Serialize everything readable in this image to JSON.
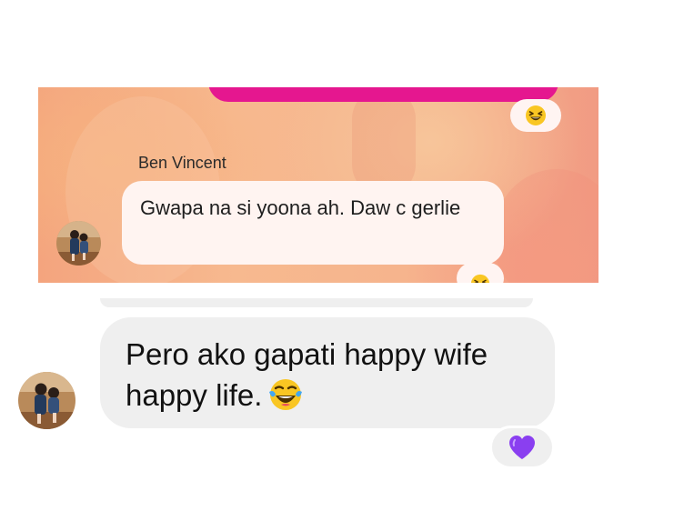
{
  "top_chat": {
    "sender_name": "Ben Vincent",
    "message": "Gwapa na si yoona ah. Daw c gerlie",
    "reactions": [
      "laughing-emoji",
      "laughing-emoji"
    ],
    "accent_color": "#e5178f"
  },
  "bottom_chat": {
    "message": "Pero ako gapati happy wife happy life.",
    "inline_emoji": "tears-of-joy-emoji",
    "reaction": "purple-heart-emoji",
    "reaction_color": "#8a3ff0",
    "bubble_color": "#efefef"
  }
}
